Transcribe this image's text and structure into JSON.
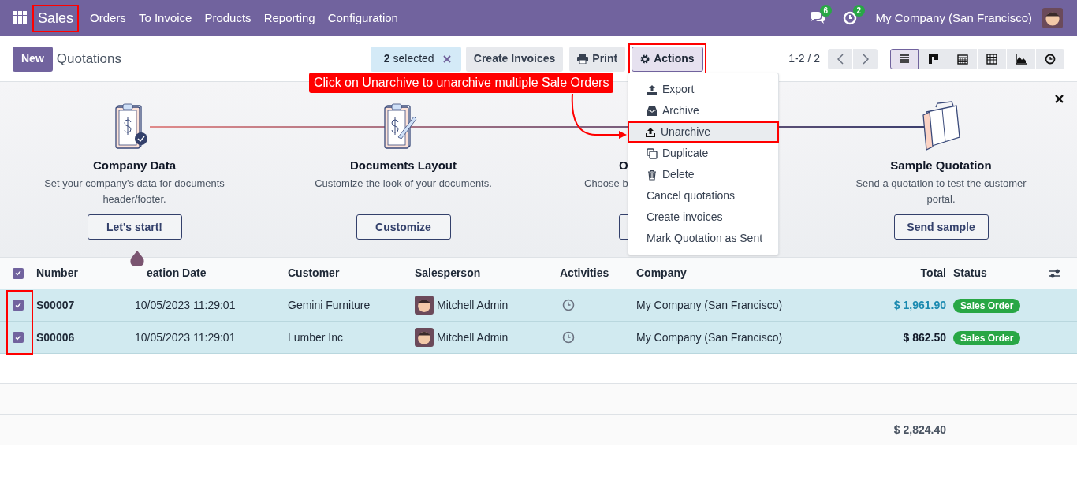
{
  "navbar": {
    "app_name": "Sales",
    "app_highlighted": true,
    "menu": [
      "Orders",
      "To Invoice",
      "Products",
      "Reporting",
      "Configuration"
    ],
    "messages_count": "6",
    "activities_count": "2",
    "company": "My Company (San Francisco)"
  },
  "control_panel": {
    "new_button": "New",
    "title": "Quotations",
    "selection": {
      "count": "2",
      "label": "selected"
    },
    "buttons": [
      {
        "label": "Create Invoices",
        "kind": "plain",
        "highlighted": false
      },
      {
        "label": "Print",
        "kind": "print",
        "highlighted": false
      },
      {
        "label": "Actions",
        "kind": "actions",
        "highlighted": true
      }
    ],
    "pager": "1-2 / 2",
    "views": [
      {
        "kind": "list",
        "selected": true
      },
      {
        "kind": "kanban",
        "selected": false
      },
      {
        "kind": "calendar",
        "selected": false
      },
      {
        "kind": "pivot",
        "selected": false
      },
      {
        "kind": "graph",
        "selected": false
      },
      {
        "kind": "activity",
        "selected": false
      }
    ]
  },
  "actions_menu": [
    {
      "label": "Export",
      "kind": "export",
      "highlighted": false
    },
    {
      "label": "Archive",
      "kind": "archive",
      "highlighted": false
    },
    {
      "label": "Unarchive",
      "kind": "unarchive",
      "highlighted": true
    },
    {
      "label": "Duplicate",
      "kind": "duplicate",
      "highlighted": false
    },
    {
      "label": "Delete",
      "kind": "delete",
      "highlighted": false
    },
    {
      "label": "Cancel quotations",
      "kind": "plain",
      "highlighted": false
    },
    {
      "label": "Create invoices",
      "kind": "plain",
      "highlighted": false
    },
    {
      "label": "Mark Quotation as Sent",
      "kind": "plain",
      "highlighted": false
    }
  ],
  "annotation": {
    "text": "Click on Unarchive to unarchive multiple Sale Orders"
  },
  "onboarding": {
    "steps": [
      {
        "kind": "company",
        "title": "Company Data",
        "description": "Set your company's data for documents header/footer.",
        "button": "Let's start!",
        "current": true
      },
      {
        "kind": "layout",
        "title": "Documents Layout",
        "description": "Customize the look of your documents.",
        "button": "Customize",
        "current": false
      },
      {
        "kind": "covered",
        "title": "O",
        "description": "Choose b",
        "current": false
      },
      {
        "kind": "quotation",
        "title": "Sample Quotation",
        "description": "Send a quotation to test the customer portal.",
        "button": "Send sample",
        "current": false
      }
    ]
  },
  "table": {
    "select_all_checked": true,
    "checkboxes_highlighted": true,
    "columns": [
      "Number",
      "eation Date",
      "Customer",
      "Salesperson",
      "Activities",
      "Company",
      "Total",
      "Status"
    ],
    "rows": [
      {
        "checked": true,
        "hovered": true,
        "number": "S00007",
        "creation_date": "10/05/2023 11:29:01",
        "customer": "Gemini Furniture",
        "salesperson": "Mitchell Admin",
        "company": "My Company (San Francisco)",
        "total": "$ 1,961.90",
        "status": "Sales Order"
      },
      {
        "checked": true,
        "hovered": false,
        "number": "S00006",
        "creation_date": "10/05/2023 11:29:01",
        "customer": "Lumber Inc",
        "salesperson": "Mitchell Admin",
        "company": "My Company (San Francisco)",
        "total": "$ 862.50",
        "status": "Sales Order"
      }
    ],
    "sum_total": "$ 2,824.40"
  }
}
